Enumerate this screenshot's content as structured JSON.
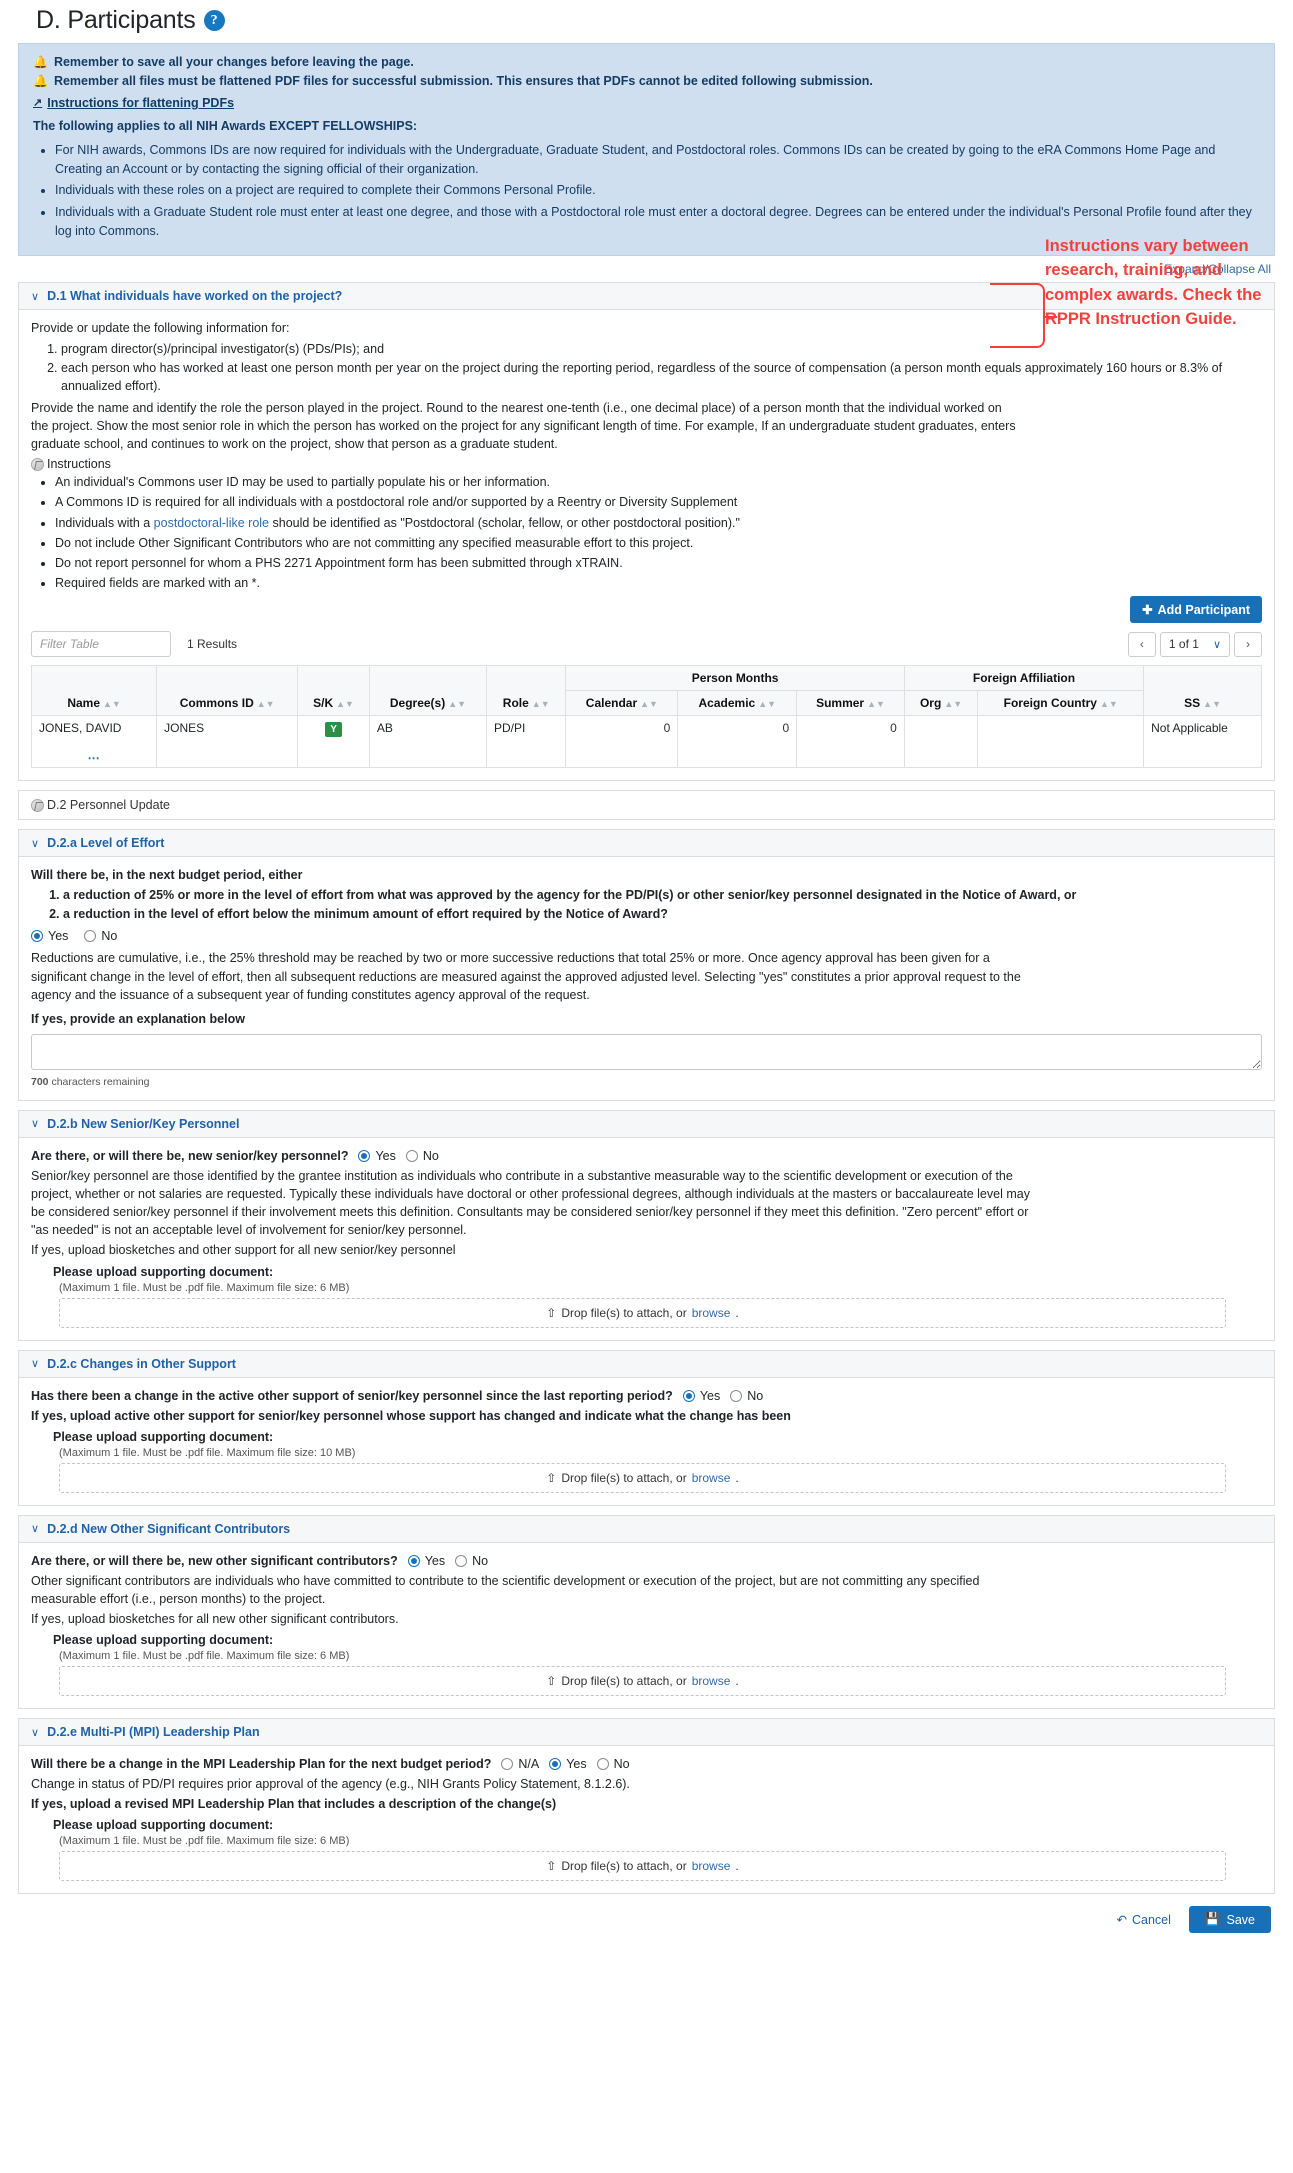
{
  "page_title": "D. Participants",
  "help_icon": "help-icon",
  "banner": {
    "notice1": "Remember to save all your changes before leaving the page.",
    "notice2": "Remember all files must be flattened PDF files for successful submission. This ensures that PDFs cannot be edited following submission.",
    "link": "Instructions for flattening PDFs",
    "applies": "The following applies to all NIH Awards EXCEPT FELLOWSHIPS:",
    "bullets": [
      "For NIH awards, Commons IDs are now required for individuals with the Undergraduate, Graduate Student, and Postdoctoral roles. Commons IDs can be created by going to the eRA Commons Home Page and Creating an Account or by contacting the signing official of their organization.",
      "Individuals with these roles on a project are required to complete their Commons Personal Profile.",
      "Individuals with a Graduate Student role must enter at least one degree, and those with a Postdoctoral role must enter a doctoral degree. Degrees can be entered under the individual's Personal Profile found after they log into Commons."
    ]
  },
  "expand_collapse": "Expand/Collapse All",
  "annotation": "Instructions vary between research, training, and complex awards. Check the RPPR Instruction Guide.",
  "d1": {
    "title": "D.1 What individuals have worked on the project?",
    "intro": "Provide or update the following information for:",
    "numbered": [
      "program director(s)/principal investigator(s) (PDs/PIs); and",
      "each person who has worked at least one person month per year on the project during the reporting period, regardless of the source of compensation (a person month equals approximately 160 hours or 8.3% of annualized effort)."
    ],
    "para": "Provide the name and identify the role the person played in the project. Round to the nearest one-tenth (i.e., one decimal place) of a person month that the individual worked on the project. Show the most senior role in which the person has worked on the project for any significant length of time. For example, If an undergraduate student graduates, enters graduate school, and continues to work on the project, show that person as a graduate student.",
    "instructions_label": "Instructions",
    "instruction_bullets": [
      "An individual's Commons user ID may be used to partially populate his or her information.",
      "A Commons ID is required for all individuals with a postdoctoral role and/or supported by a Reentry or Diversity Supplement",
      "Do not include Other Significant Contributors who are not committing any specified measurable effort to this project.",
      "Do not report personnel for whom a PHS 2271 Appointment form has been submitted through xTRAIN.",
      "Required fields are marked with an *."
    ],
    "postdoc_bullet": {
      "pre": "Individuals with a ",
      "link": "postdoctoral-like role",
      "post": " should be identified as \"Postdoctoral (scholar, fellow, or other postdoctoral position).\""
    },
    "add_participant": "Add Participant",
    "filter_placeholder": "Filter Table",
    "results": "1 Results",
    "pager": {
      "prev": "‹",
      "value": "1 of 1",
      "next": "›"
    },
    "table": {
      "group_person_months": "Person Months",
      "group_foreign_affiliation": "Foreign Affiliation",
      "columns": [
        "Name",
        "Commons ID",
        "S/K",
        "Degree(s)",
        "Role",
        "Calendar",
        "Academic",
        "Summer",
        "Org",
        "Foreign Country",
        "SS"
      ],
      "rows": [
        {
          "name": "JONES, DAVID",
          "commons_id": "JONES",
          "sk": "Y",
          "degrees": "AB",
          "role": "PD/PI",
          "calendar": "0",
          "academic": "0",
          "summer": "0",
          "org": "",
          "foreign_country": "",
          "ss": "Not Applicable"
        }
      ]
    }
  },
  "d2_label": "D.2 Personnel Update",
  "d2a": {
    "title": "D.2.a Level of Effort",
    "lead": "Will there be, in the next budget period, either",
    "numbered": [
      "a reduction of 25% or more in the level of effort from what was approved by the agency for the PD/PI(s) or other senior/key personnel designated in the Notice of Award, or",
      "a reduction in the level of effort below the minimum amount of effort required by the Notice of Award?"
    ],
    "yes": "Yes",
    "no": "No",
    "selected": "Yes",
    "para": "Reductions are cumulative, i.e., the 25% threshold may be reached by two or more successive reductions that total 25% or more. Once agency approval has been given for a significant change in the level of effort, then all subsequent reductions are measured against the approved adjusted level. Selecting \"yes\" constitutes a prior approval request to the agency and the issuance of a subsequent year of funding constitutes agency approval of the request.",
    "explain_label": "If yes, provide an explanation below",
    "textarea_value": "",
    "char_count_number": "700",
    "char_count_text": "characters remaining"
  },
  "d2b": {
    "title": "D.2.b New Senior/Key Personnel",
    "question": "Are there, or will there be, new senior/key personnel?",
    "yes": "Yes",
    "no": "No",
    "selected": "Yes",
    "para": "Senior/key personnel are those identified by the grantee institution as individuals who contribute in a substantive measurable way to the scientific development or execution of the project, whether or not salaries are requested. Typically these individuals have doctoral or other professional degrees, although individuals at the masters or baccalaureate level may be considered senior/key personnel if their involvement meets this definition. Consultants may be considered senior/key personnel if they meet this definition. \"Zero percent\" effort or \"as needed\" is not an acceptable level of involvement for senior/key personnel.",
    "para2": "If yes, upload biosketches and other support for all new senior/key personnel",
    "upload_label": "Please upload supporting document:",
    "upload_note": "(Maximum 1 file. Must be .pdf file. Maximum file size: 6 MB)",
    "drop_text": "Drop file(s) to attach, or",
    "drop_link": "browse",
    "drop_suffix": "."
  },
  "d2c": {
    "title": "D.2.c Changes in Other Support",
    "question": "Has there been a change in the active other support of senior/key personnel since the last reporting period?",
    "yes": "Yes",
    "no": "No",
    "selected": "Yes",
    "para": "If yes, upload active other support for senior/key personnel whose support has changed and indicate what the change has been",
    "upload_label": "Please upload supporting document:",
    "upload_note": "(Maximum 1 file. Must be .pdf file. Maximum file size: 10 MB)",
    "drop_text": "Drop file(s) to attach, or",
    "drop_link": "browse",
    "drop_suffix": "."
  },
  "d2d": {
    "title": "D.2.d New Other Significant Contributors",
    "question": "Are there, or will there be, new other significant contributors?",
    "yes": "Yes",
    "no": "No",
    "selected": "Yes",
    "para": "Other significant contributors are individuals who have committed to contribute to the scientific development or execution of the project, but are not committing any specified measurable effort (i.e., person months) to the project.",
    "para2": "If yes, upload biosketches for all new other significant contributors.",
    "upload_label": "Please upload supporting document:",
    "upload_note": "(Maximum 1 file. Must be .pdf file. Maximum file size: 6 MB)",
    "drop_text": "Drop file(s) to attach, or",
    "drop_link": "browse",
    "drop_suffix": "."
  },
  "d2e": {
    "title": "D.2.e Multi-PI (MPI) Leadership Plan",
    "question": "Will there be a change in the MPI Leadership Plan for the next budget period?",
    "na": "N/A",
    "yes": "Yes",
    "no": "No",
    "selected": "Yes",
    "para": "Change in status of PD/PI requires prior approval of the agency (e.g., NIH Grants Policy Statement, 8.1.2.6).",
    "para2": "If yes, upload a revised MPI Leadership Plan that includes a description of the change(s)",
    "upload_label": "Please upload supporting document:",
    "upload_note": "(Maximum 1 file. Must be .pdf file. Maximum file size: 6 MB)",
    "drop_text": "Drop file(s) to attach, or",
    "drop_link": "browse",
    "drop_suffix": "."
  },
  "footer": {
    "cancel": "Cancel",
    "save": "Save"
  },
  "colors": {
    "accent": "#1870b8",
    "banner_bg": "#cfdff0",
    "annotation": "#f2413c",
    "badge_green": "#2a9045"
  }
}
